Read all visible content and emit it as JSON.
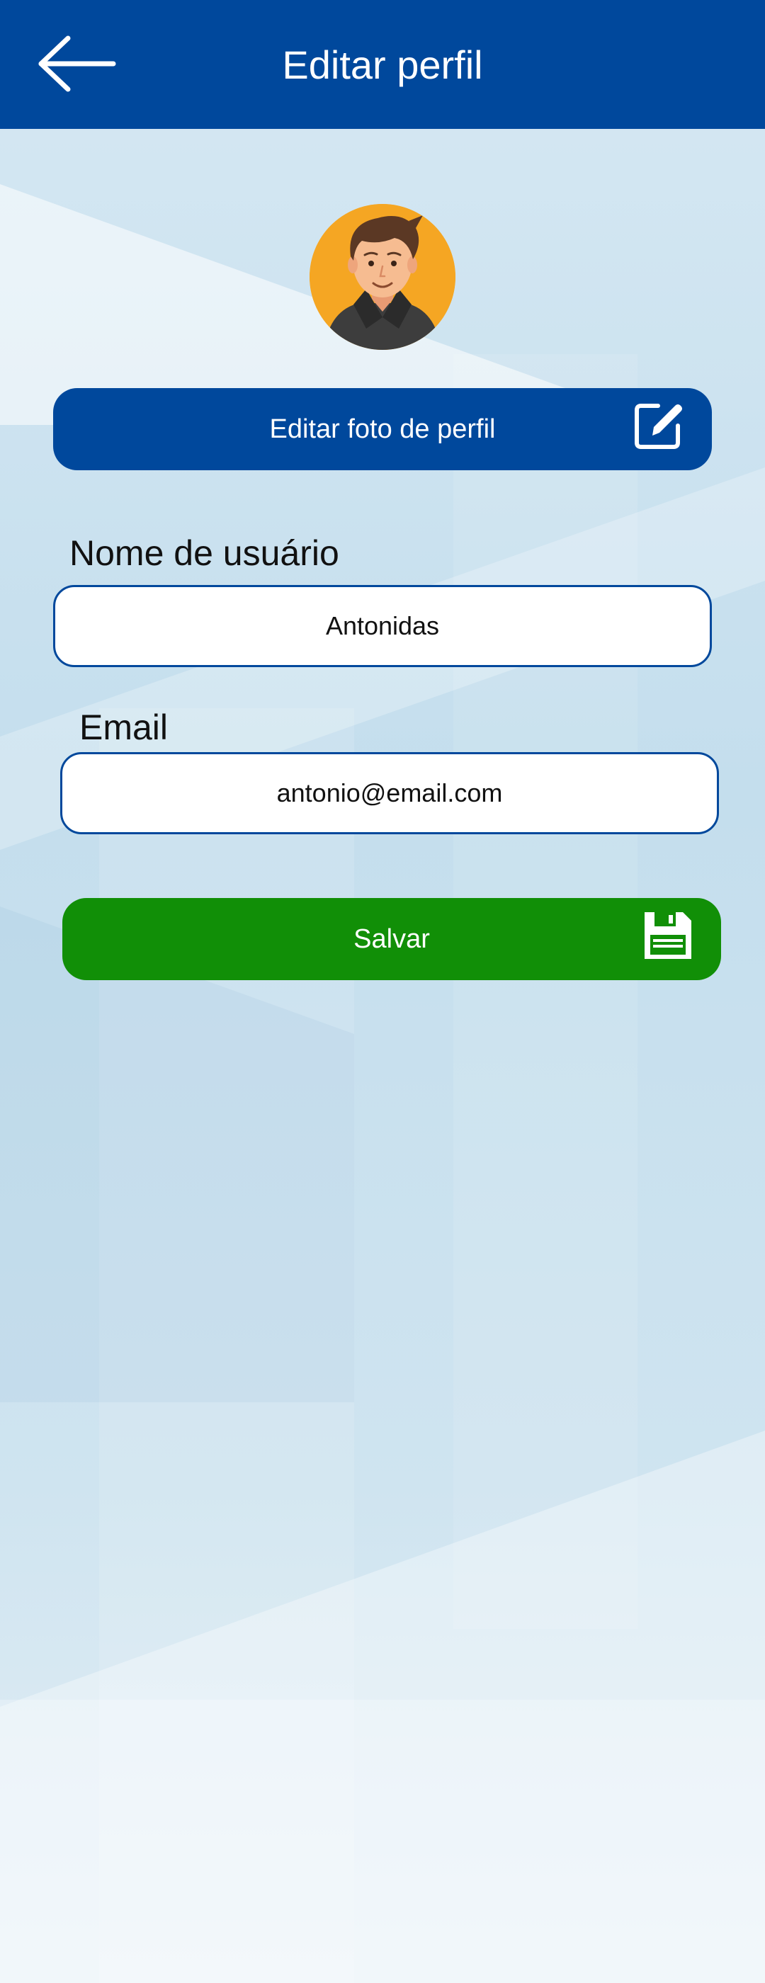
{
  "header": {
    "title": "Editar perfil",
    "back_icon": "arrow-left-icon"
  },
  "profile": {
    "avatar": "avatar-illustration",
    "edit_photo_label": "Editar foto de perfil",
    "edit_photo_icon": "edit-square-icon"
  },
  "form": {
    "username_label": "Nome de usuário",
    "username_value": "Antonidas",
    "email_label": "Email",
    "email_value": "antonio@email.com"
  },
  "actions": {
    "save_label": "Salvar",
    "save_icon": "floppy-disk-icon"
  },
  "colors": {
    "primary": "#00489c",
    "save": "#118f07",
    "avatar_bg": "#f5a623"
  }
}
